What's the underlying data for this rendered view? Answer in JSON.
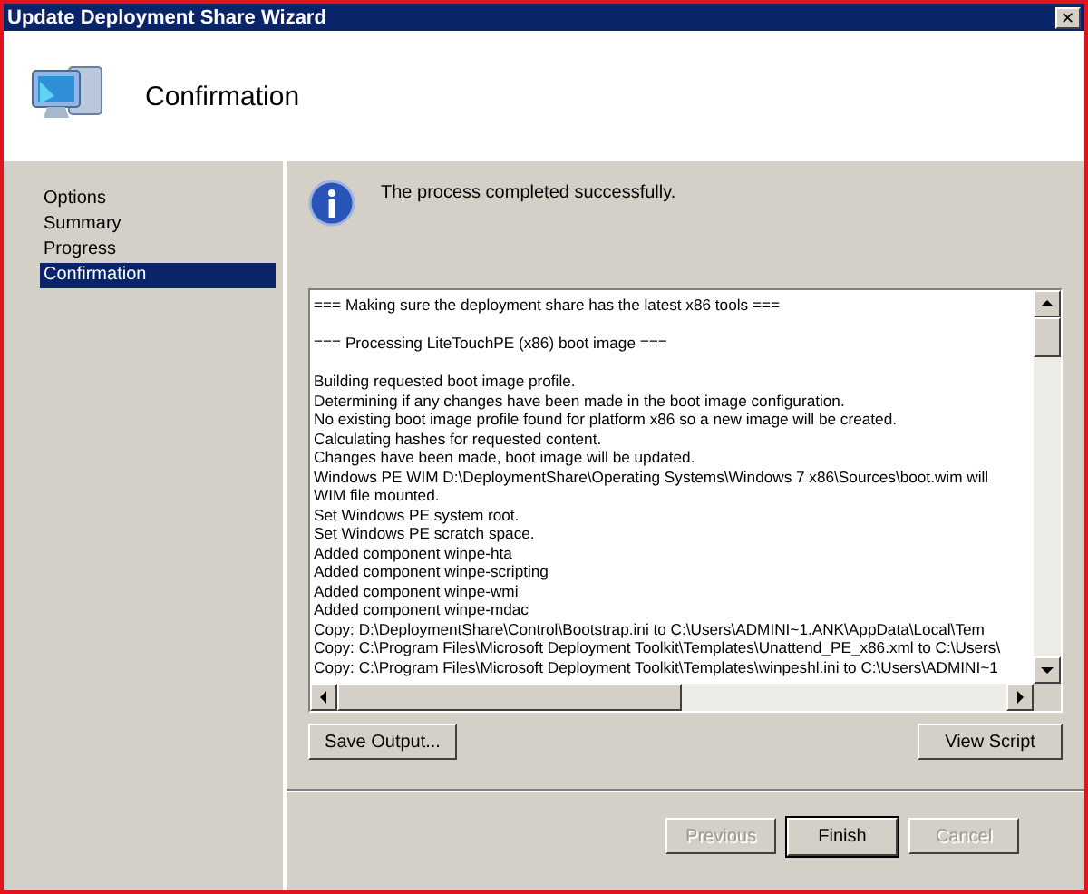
{
  "window": {
    "title": "Update Deployment Share Wizard",
    "close": "✕"
  },
  "header": {
    "title": "Confirmation"
  },
  "steps": [
    {
      "label": "Options",
      "selected": false
    },
    {
      "label": "Summary",
      "selected": false
    },
    {
      "label": "Progress",
      "selected": false
    },
    {
      "label": "Confirmation",
      "selected": true
    }
  ],
  "message": "The process completed successfully.",
  "log": [
    {
      "kind": "banner",
      "text": "=== Making sure the deployment share has the latest x86 tools ==="
    },
    {
      "kind": "banner",
      "text": "=== Processing LiteTouchPE (x86) boot image ==="
    },
    {
      "kind": "line",
      "text": "Building requested boot image profile."
    },
    {
      "kind": "line",
      "text": "Determining if any changes have been made in the boot image configuration."
    },
    {
      "kind": "line",
      "text": "No existing boot image profile found for platform x86 so a new image will be created."
    },
    {
      "kind": "line",
      "text": "Calculating hashes for requested content."
    },
    {
      "kind": "line",
      "text": "Changes have been made, boot image will be updated."
    },
    {
      "kind": "line",
      "text": "Windows PE WIM D:\\DeploymentShare\\Operating Systems\\Windows 7 x86\\Sources\\boot.wim will"
    },
    {
      "kind": "line",
      "text": "WIM file mounted."
    },
    {
      "kind": "line",
      "text": "Set Windows PE system root."
    },
    {
      "kind": "line",
      "text": "Set Windows PE scratch space."
    },
    {
      "kind": "line",
      "text": "Added component winpe-hta"
    },
    {
      "kind": "line",
      "text": "Added component winpe-scripting"
    },
    {
      "kind": "line",
      "text": "Added component winpe-wmi"
    },
    {
      "kind": "line",
      "text": "Added component winpe-mdac"
    },
    {
      "kind": "line",
      "text": "Copy: D:\\DeploymentShare\\Control\\Bootstrap.ini to C:\\Users\\ADMINI~1.ANK\\AppData\\Local\\Tem"
    },
    {
      "kind": "line",
      "text": "Copy: C:\\Program Files\\Microsoft Deployment Toolkit\\Templates\\Unattend_PE_x86.xml to C:\\Users\\"
    },
    {
      "kind": "line",
      "text": "Copy: C:\\Program Files\\Microsoft Deployment Toolkit\\Templates\\winpeshl.ini to C:\\Users\\ADMINI~1"
    }
  ],
  "log_buttons": [
    {
      "label": "Save Output..."
    },
    {
      "label": "View Script"
    }
  ],
  "nav_buttons": [
    {
      "label": "Previous",
      "disabled": true,
      "default": false
    },
    {
      "label": "Finish",
      "disabled": false,
      "default": true
    },
    {
      "label": "Cancel",
      "disabled": true,
      "default": false
    }
  ]
}
